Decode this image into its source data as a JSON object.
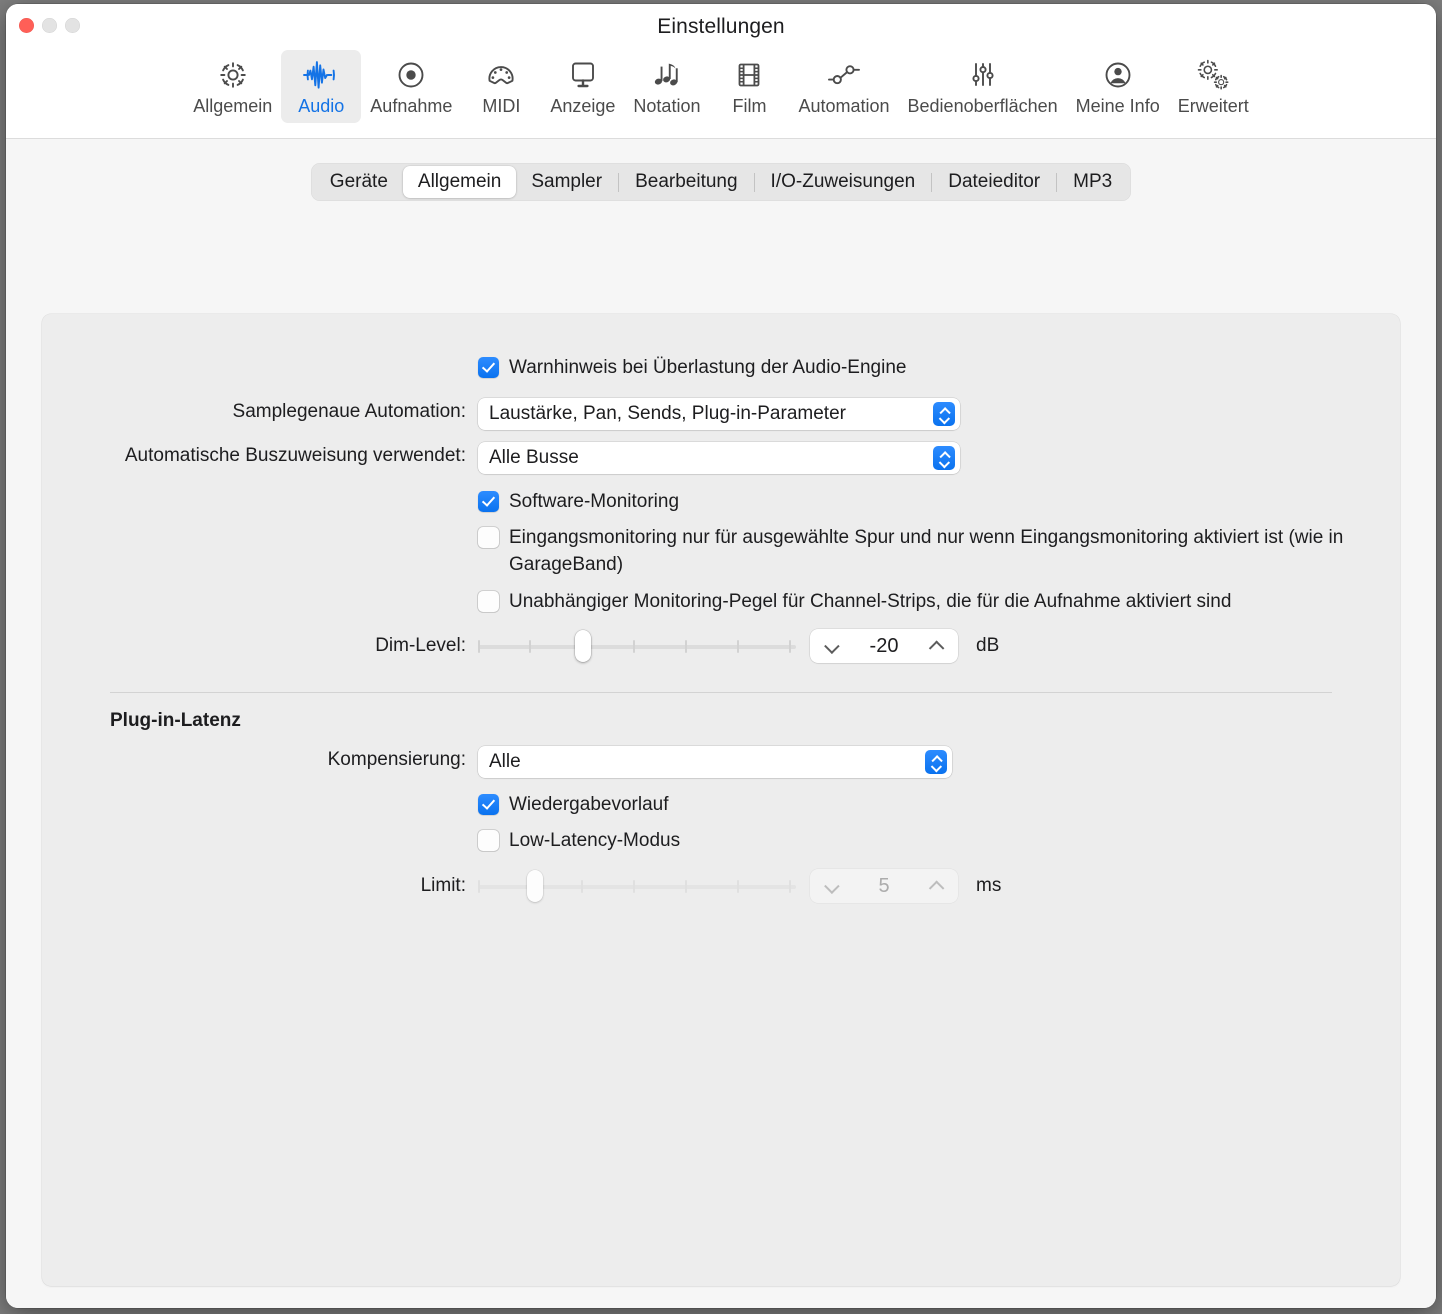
{
  "window": {
    "title": "Einstellungen",
    "traffic_lights": [
      "close-button",
      "minimize-button",
      "zoom-button"
    ]
  },
  "toolbar": {
    "items": [
      {
        "label": "Allgemein",
        "icon": "gear-icon",
        "selected": false
      },
      {
        "label": "Audio",
        "icon": "waveform-icon",
        "selected": true
      },
      {
        "label": "Aufnahme",
        "icon": "record-circle-icon",
        "selected": false
      },
      {
        "label": "MIDI",
        "icon": "midi-connector-icon",
        "selected": false
      },
      {
        "label": "Anzeige",
        "icon": "display-monitor-icon",
        "selected": false
      },
      {
        "label": "Notation",
        "icon": "music-notes-icon",
        "selected": false
      },
      {
        "label": "Film",
        "icon": "film-strip-icon",
        "selected": false
      },
      {
        "label": "Automation",
        "icon": "automation-nodes-icon",
        "selected": false
      },
      {
        "label": "Bedienoberflächen",
        "icon": "faders-icon",
        "selected": false
      },
      {
        "label": "Meine Info",
        "icon": "person-circle-icon",
        "selected": false
      },
      {
        "label": "Erweitert",
        "icon": "double-gear-icon",
        "selected": false
      }
    ]
  },
  "tabs": {
    "items": [
      {
        "label": "Geräte",
        "active": false,
        "separator_after": false
      },
      {
        "label": "Allgemein",
        "active": true,
        "separator_after": false
      },
      {
        "label": "Sampler",
        "active": false,
        "separator_after": true
      },
      {
        "label": "Bearbeitung",
        "active": false,
        "separator_after": true
      },
      {
        "label": "I/O-Zuweisungen",
        "active": false,
        "separator_after": true
      },
      {
        "label": "Dateieditor",
        "active": false,
        "separator_after": true
      },
      {
        "label": "MP3",
        "active": false,
        "separator_after": false
      }
    ]
  },
  "general": {
    "overload_warning": {
      "label": "Warnhinweis bei Überlastung der Audio-Engine",
      "checked": true
    },
    "sample_accurate_automation": {
      "label": "Samplegenaue Automation:",
      "value": "Laustärke, Pan, Sends, Plug-in-Parameter"
    },
    "automatic_bus_assignment": {
      "label": "Automatische Buszuweisung verwendet:",
      "value": "Alle Busse"
    },
    "software_monitoring": {
      "label": "Software-Monitoring",
      "checked": true
    },
    "input_monitoring_selected_track": {
      "label": "Eingangsmonitoring nur für ausgewählte Spur und nur wenn Eingangsmonitoring aktiviert ist (wie in GarageBand)",
      "checked": false
    },
    "independent_monitoring_level": {
      "label": "Unabhängiger Monitoring-Pegel für Channel-Strips, die für die Aufnahme aktiviert sind",
      "checked": false
    },
    "dim_level": {
      "label": "Dim-Level:",
      "value": "-20",
      "unit": "dB",
      "tick_count": 7,
      "thumb_index": 2,
      "disabled": false
    }
  },
  "plugin_latency": {
    "section_title": "Plug-in-Latenz",
    "compensation": {
      "label": "Kompensierung:",
      "value": "Alle"
    },
    "playback_prerun": {
      "label": "Wiedergabevorlauf",
      "checked": true
    },
    "low_latency_mode": {
      "label": "Low-Latency-Modus",
      "checked": false
    },
    "limit": {
      "label": "Limit:",
      "value": "5",
      "unit": "ms",
      "tick_count": 7,
      "thumb_index": 1,
      "disabled": true
    }
  },
  "colors": {
    "accent_blue": "#0a72ef",
    "selected_tab_text": "#1473e6",
    "close_red": "#ff5f57",
    "window_bg": "#f6f6f6",
    "panel_bg": "#ededed"
  }
}
